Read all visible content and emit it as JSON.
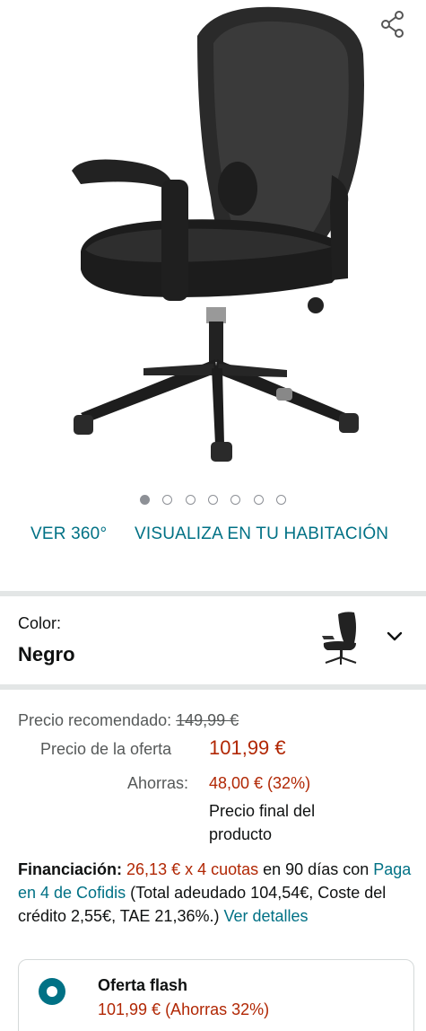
{
  "gallery": {
    "image_alt": "silla de oficina negra",
    "dot_count": 7,
    "active_dot": 0,
    "link_360": "VER 360°",
    "link_room": "VISUALIZA EN TU HABITACIÓN",
    "share_icon": "share-icon"
  },
  "color": {
    "label": "Color:",
    "value": "Negro",
    "chevron_icon": "chevron-down-icon"
  },
  "price": {
    "recommended_label": "Precio recomendado:",
    "recommended_value": "149,99 €",
    "offer_label": "Precio de la oferta",
    "offer_value": "101,99 €",
    "savings_label": "Ahorras:",
    "savings_value": "48,00 € (32%)",
    "final_note_line1": "Precio final del",
    "final_note_line2": "producto"
  },
  "financing": {
    "label": "Financiación:",
    "installments": "26,13 € x 4 cuotas",
    "text1": " en 90 días con ",
    "provider": "Paga en 4 de Cofidis",
    "text2": " (Total adeudado 104,54€, Coste del crédito 2,55€, TAE 21,36%.) ",
    "details_link": "Ver detalles"
  },
  "offer": {
    "title": "Oferta flash",
    "price": "101,99 € (Ahorras 32%)"
  },
  "colors": {
    "teal": "#007185",
    "red": "#b12704",
    "divider": "#e3e6e6"
  }
}
